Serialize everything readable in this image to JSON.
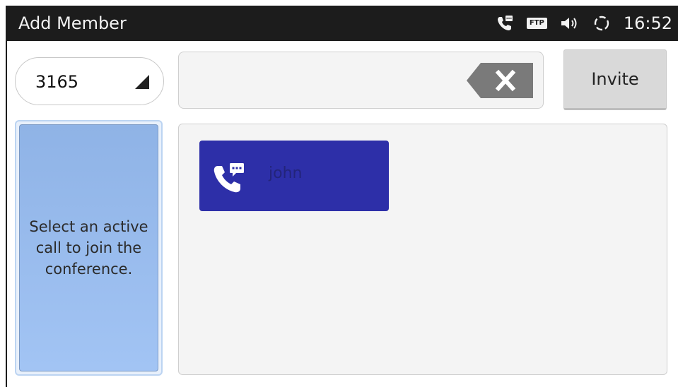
{
  "status_bar": {
    "title": "Add Member",
    "ftp_label": "FTP",
    "time": "16:52",
    "icons": [
      "voicemail-call-icon",
      "ftp-icon",
      "volume-icon",
      "sync-icon"
    ]
  },
  "account": {
    "selected": "3165"
  },
  "dial": {
    "value": "",
    "placeholder": ""
  },
  "invite_label": "Invite",
  "active_call": {
    "message": "Select an active call to join the conference."
  },
  "contacts": [
    {
      "name": "john",
      "icon": "call-message-icon"
    }
  ],
  "colors": {
    "status_bar": "#1c1c1c",
    "contact_card": "#2d2fa8",
    "active_call_panel": "#9dbff0",
    "invite_button": "#d9d9d9"
  }
}
